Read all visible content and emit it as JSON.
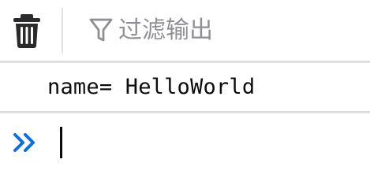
{
  "toolbar": {
    "clear_icon": "trash-icon",
    "filter_icon": "funnel-icon",
    "filter_placeholder": "过滤输出",
    "filter_value": ""
  },
  "output": {
    "lines": [
      "name= HelloWorld"
    ]
  },
  "input": {
    "prompt_icon": "double-chevron-right-icon",
    "value": ""
  },
  "colors": {
    "icon_dark": "#2b2b2e",
    "icon_gray": "#8f8f95",
    "prompt_blue": "#0a6fdb",
    "divider": "#e0e0e2"
  }
}
